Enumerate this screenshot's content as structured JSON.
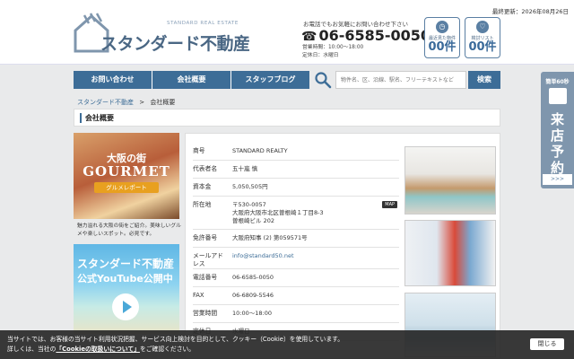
{
  "header": {
    "updated": "最終更新：2026年08月26日",
    "logo_en": "STANDARD REAL ESTATE",
    "logo_jp": "スタンダード不動産",
    "contact_note": "お電話でもお気軽にお問い合わせ下さい",
    "phone_icon": "☎",
    "tel": "06-6585-0050",
    "hours_line": "営業時間：10:00～18:00",
    "holiday_line": "定休日：水曜日",
    "recent_viewed": {
      "icon": "clock-icon",
      "label": "最近見た物件",
      "count": "00件"
    },
    "favorites": {
      "icon": "heart-icon",
      "label": "検討リスト",
      "count": "00件"
    }
  },
  "nav": {
    "items": [
      "お問い合わせ",
      "会社概要",
      "スタッフブログ"
    ]
  },
  "search": {
    "placeholder": "物件名、区、沿線、駅名、フリーテキストなど",
    "button": "検索"
  },
  "breadcrumb": {
    "home": "スタンダード不動産",
    "sep": ">",
    "current": "会社概要"
  },
  "page_title": "会社概要",
  "sidebar": {
    "banner1": {
      "jp": "大阪の街",
      "en": "GOURMET",
      "tag": "グルメレポート"
    },
    "banner1_text": "魅力溢れる大阪の街をご紹介。美味しいグルメや楽しいスポット。必見です。",
    "banner2": {
      "line1": "スタンダード不動産",
      "line2": "公式YouTube公開中"
    }
  },
  "company": {
    "rows": [
      {
        "label": "商号",
        "value": "STANDARD REALTY"
      },
      {
        "label": "代表者名",
        "value": "五十嵐 慎"
      },
      {
        "label": "資本金",
        "value": "5,050,505円"
      },
      {
        "label": "所在地",
        "value_lines": [
          "〒530-0057",
          "大阪府大阪市北区曽根崎１丁目8-3",
          "曽根崎ビル 202"
        ],
        "badge": "MAP"
      },
      {
        "label": "免許番号",
        "value": "大阪府知事 (2) 第059571号"
      },
      {
        "label": "メールアドレス",
        "value": "info@standard50.net"
      },
      {
        "label": "電話番号",
        "value": "06-6585-0050"
      },
      {
        "label": "FAX",
        "value": "06-6809-5546"
      },
      {
        "label": "営業時間",
        "value": "10:00～18:00"
      },
      {
        "label": "定休日",
        "value": "水曜日"
      }
    ]
  },
  "side_tab": {
    "top": "簡単60秒",
    "main": "来店予約",
    "arrow": ">>>"
  },
  "cookie": {
    "line1": "当サイトでは、お客様の当サイト利用状況把握、サービス向上検討を目的として、クッキー（Cookie）を使用しています。",
    "line2_pre": "詳しくは、当社の",
    "line2_link": "「Cookieの取扱いについて」",
    "line2_post": "をご確認ください。",
    "close": "閉じる"
  },
  "colors": {
    "brand": "#3d6d97",
    "accent": "#5a7fa3",
    "cookie_bg": "#282828"
  }
}
